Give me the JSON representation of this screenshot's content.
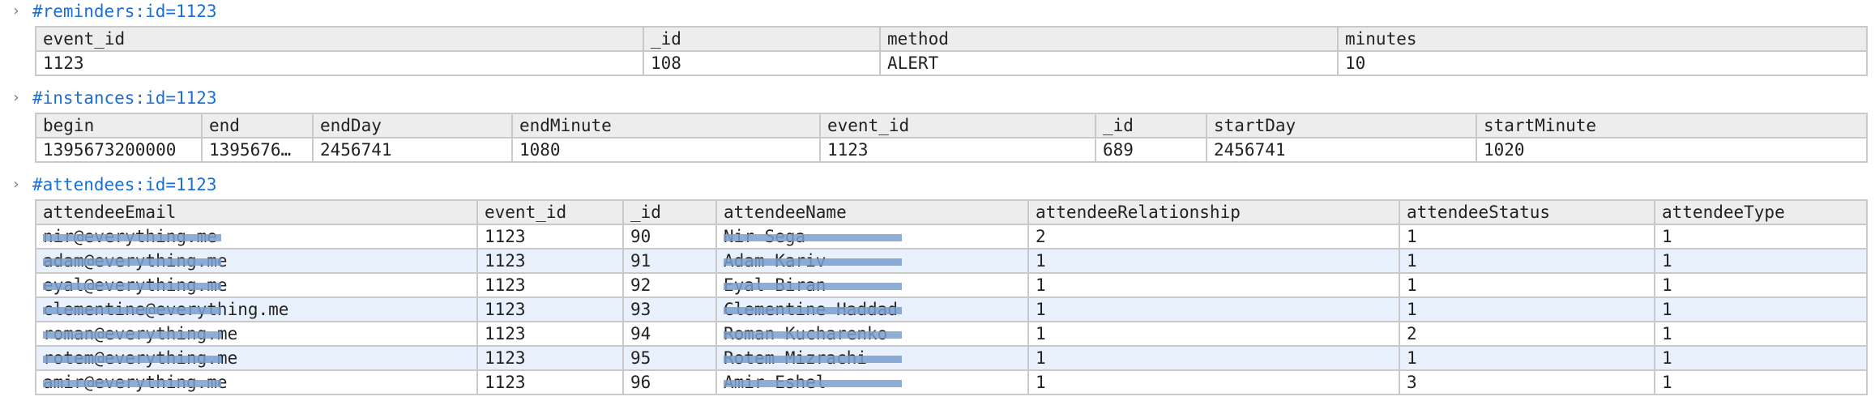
{
  "colors": {
    "title": "#1a6fd6",
    "header_bg": "#ededed",
    "border": "#c9c9c9",
    "row_alt": "#e9f1fd",
    "redaction": "#7a9fd0"
  },
  "sections": [
    {
      "toggle_icon": "chevron-right-icon",
      "toggle_glyph": "›",
      "title": "#reminders:id=1123",
      "columns": [
        "event_id",
        "_id",
        "method",
        "minutes"
      ],
      "rows": [
        [
          "1123",
          "108",
          "ALERT",
          "10"
        ]
      ]
    },
    {
      "toggle_icon": "chevron-right-icon",
      "toggle_glyph": "›",
      "title": "#instances:id=1123",
      "columns": [
        "begin",
        "end",
        "endDay",
        "endMinute",
        "event_id",
        "_id",
        "startDay",
        "startMinute"
      ],
      "rows": [
        [
          "1395673200000",
          "1395676…",
          "2456741",
          "1080",
          "1123",
          "689",
          "2456741",
          "1020"
        ]
      ]
    },
    {
      "toggle_icon": "chevron-right-icon",
      "toggle_glyph": "›",
      "title": "#attendees:id=1123",
      "columns": [
        "attendeeEmail",
        "event_id",
        "_id",
        "attendeeName",
        "attendeeRelationship",
        "attendeeStatus",
        "attendeeType"
      ],
      "rows": [
        [
          "nir@everything.me",
          "1123",
          "90",
          "Nir Sega",
          "2",
          "1",
          "1"
        ],
        [
          "adam@everything.me",
          "1123",
          "91",
          "Adam Kariv",
          "1",
          "1",
          "1"
        ],
        [
          "eyal@everything.me",
          "1123",
          "92",
          "Eyal Biran",
          "1",
          "1",
          "1"
        ],
        [
          "clementine@everything.me",
          "1123",
          "93",
          "Clementine Haddad",
          "1",
          "1",
          "1"
        ],
        [
          "roman@everything.me",
          "1123",
          "94",
          "Roman Kucharenko",
          "1",
          "2",
          "1"
        ],
        [
          "rotem@everything.me",
          "1123",
          "95",
          "Rotem Mizrachi",
          "1",
          "1",
          "1"
        ],
        [
          "amir@everything.me",
          "1123",
          "96",
          "Amir Eshel",
          "1",
          "3",
          "1"
        ]
      ]
    }
  ]
}
